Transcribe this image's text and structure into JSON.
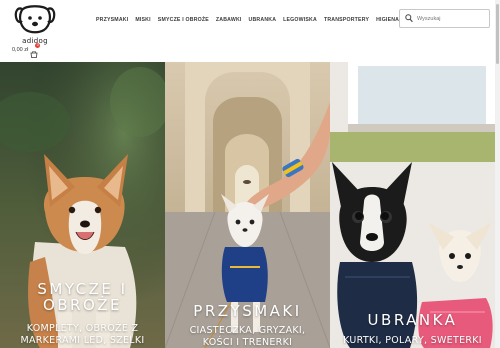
{
  "brand": {
    "name": "adidog",
    "logo_icon": "dog-head-logo-icon"
  },
  "nav": {
    "items": [
      {
        "label": "PRZYSMAKI"
      },
      {
        "label": "MISKI"
      },
      {
        "label": "SMYCZE I OBROŻE"
      },
      {
        "label": "ZABAWKI"
      },
      {
        "label": "UBRANKA"
      },
      {
        "label": "LEGOWISKA"
      },
      {
        "label": "TRANSPORTERY"
      },
      {
        "label": "HIGIENA",
        "has_dropdown": true
      }
    ]
  },
  "search": {
    "placeholder": "Wyszukaj",
    "icon": "search-icon"
  },
  "cart": {
    "total": "0,00 zł",
    "count": "0",
    "icon": "cart-icon"
  },
  "categories": [
    {
      "title_lines": [
        "SMYCZE I",
        "OBROŻE"
      ],
      "subtitle_lines": [
        "KOMPLETY, OBROŻE Z",
        "MARKERAMI LED, SZELKI"
      ],
      "photo": "corgi"
    },
    {
      "title_lines": [
        "PRZYSMAKI"
      ],
      "subtitle_lines": [
        "CIASTECZKA, GRYZAKI,",
        "KOŚCI I TRENERKI"
      ],
      "photo": "small-dog-treat"
    },
    {
      "title_lines": [
        "UBRANKA"
      ],
      "subtitle_lines": [
        "KURTKI, POLARY, SWETERKI"
      ],
      "photo": "dogs-in-sweaters"
    }
  ],
  "colors": {
    "nav_text": "#3a3a3a",
    "badge": "#e2403a",
    "overlay_text": "#ffffff"
  }
}
